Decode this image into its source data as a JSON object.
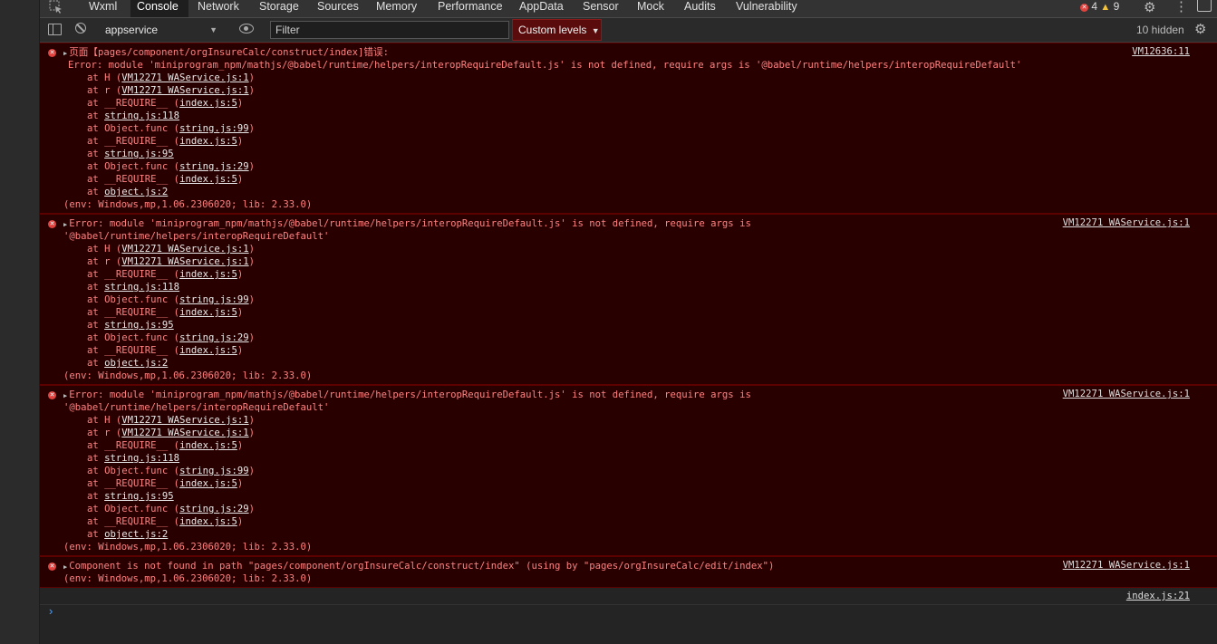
{
  "tabs": [
    "Wxml",
    "Console",
    "Network",
    "Storage",
    "Sources",
    "Memory",
    "Performance",
    "AppData",
    "Sensor",
    "Mock",
    "Audits",
    "Vulnerability"
  ],
  "status": {
    "errors": "4",
    "warnings": "9"
  },
  "toolbar": {
    "context": "appservice",
    "filter_placeholder": "Filter",
    "levels": "Custom levels",
    "hidden": "10 hidden"
  },
  "colors": {
    "error_bg": "#290000",
    "error_text": "#ff8080",
    "accent": "#4aa3ff"
  },
  "entries": [
    {
      "header": "页面【pages/component/orgInsureCalc/construct/index]错误:",
      "error": "Error: module 'miniprogram_npm/mathjs/@babel/runtime/helpers/interopRequireDefault.js' is not defined, require args is '@babel/runtime/helpers/interopRequireDefault'",
      "source": "VM12636:11",
      "frames": [
        {
          "pre": "at H (",
          "link": "VM12271 WAService.js:1",
          "post": ")"
        },
        {
          "pre": "at r (",
          "link": "VM12271 WAService.js:1",
          "post": ")"
        },
        {
          "pre": "at __REQUIRE__ (",
          "link": "index.js:5",
          "post": ")"
        },
        {
          "pre": "at ",
          "link": "string.js:118",
          "post": ""
        },
        {
          "pre": "at Object.func (",
          "link": "string.js:99",
          "post": ")"
        },
        {
          "pre": "at __REQUIRE__ (",
          "link": "index.js:5",
          "post": ")"
        },
        {
          "pre": "at ",
          "link": "string.js:95",
          "post": ""
        },
        {
          "pre": "at Object.func (",
          "link": "string.js:29",
          "post": ")"
        },
        {
          "pre": "at __REQUIRE__ (",
          "link": "index.js:5",
          "post": ")"
        },
        {
          "pre": "at ",
          "link": "object.js:2",
          "post": ""
        }
      ],
      "env": "(env: Windows,mp,1.06.2306020; lib: 2.33.0)"
    },
    {
      "line1": "Error: module 'miniprogram_npm/mathjs/@babel/runtime/helpers/interopRequireDefault.js' is not defined, require args is",
      "line2": "'@babel/runtime/helpers/interopRequireDefault'",
      "source": "VM12271 WAService.js:1",
      "env": "(env: Windows,mp,1.06.2306020; lib: 2.33.0)"
    },
    {
      "line1": "Error: module 'miniprogram_npm/mathjs/@babel/runtime/helpers/interopRequireDefault.js' is not defined, require args is",
      "line2": "'@babel/runtime/helpers/interopRequireDefault'",
      "source": "VM12271 WAService.js:1",
      "env": "(env: Windows,mp,1.06.2306020; lib: 2.33.0)"
    },
    {
      "line1": "Component is not found in path \"pages/component/orgInsureCalc/construct/index\" (using by \"pages/orgInsureCalc/edit/index\")",
      "source": "VM12271 WAService.js:1",
      "env": "(env: Windows,mp,1.06.2306020; lib: 2.33.0)"
    }
  ],
  "log": {
    "source": "index.js:21"
  }
}
